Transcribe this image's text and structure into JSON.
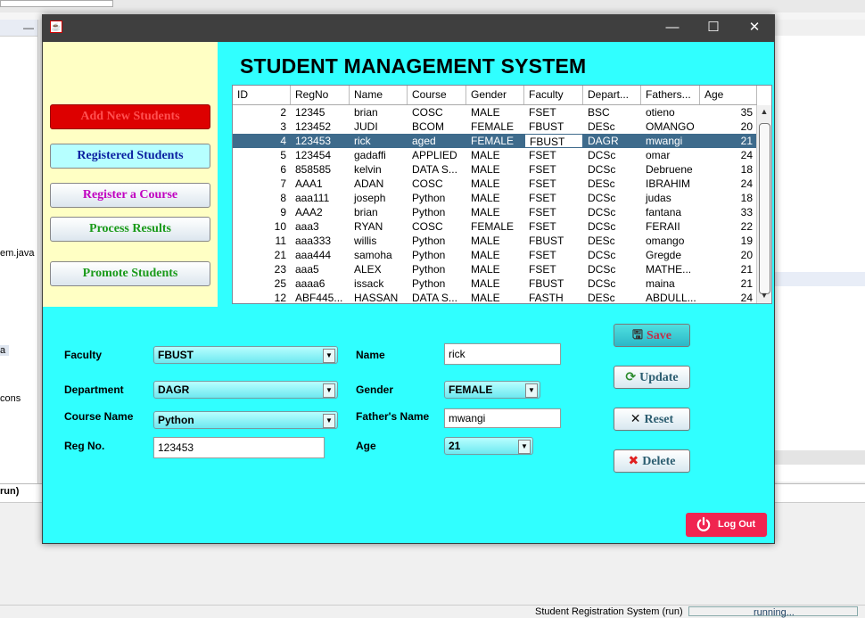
{
  "ide": {
    "left_file": "em.java",
    "left_a": "a",
    "left_icons": "cons",
    "run_label": "run)",
    "status_text": "Student Registration System (run)",
    "status_progress": "running..."
  },
  "window": {
    "minimize": "—",
    "maximize": "☐",
    "close": "✕"
  },
  "app": {
    "title": "STUDENT MANAGEMENT SYSTEM"
  },
  "nav": {
    "add_new": "Add New Students",
    "registered": "Registered Students",
    "register_course": "Register a Course",
    "process_results": "Process Results",
    "promote": "Promote Students"
  },
  "colors": {
    "client_bg": "#30ffff",
    "left_panel_bg": "#ffffc4",
    "selected_row": "#3e6b8c",
    "add_new_btn": "#dd0000",
    "logout_btn": "#f02550"
  },
  "table": {
    "columns": [
      "ID",
      "RegNo",
      "Name",
      "Course",
      "Gender",
      "Faculty",
      "Depart...",
      "Fathers...",
      "Age"
    ],
    "rows": [
      [
        "2",
        "12345",
        "brian",
        "COSC",
        "MALE",
        "FSET",
        "BSC",
        "otieno",
        "35"
      ],
      [
        "3",
        "123452",
        "JUDI",
        "BCOM",
        "FEMALE",
        "FBUST",
        "DESc",
        "OMANGO",
        "20"
      ],
      [
        "4",
        "123453",
        "rick",
        "aged",
        "FEMALE",
        "FBUST",
        "DAGR",
        "mwangi",
        "21"
      ],
      [
        "5",
        "123454",
        "gadaffi",
        "APPLIED",
        "MALE",
        "FSET",
        "DCSc",
        "omar",
        "24"
      ],
      [
        "6",
        "858585",
        "kelvin",
        "DATA S...",
        "MALE",
        "FSET",
        "DCSc",
        "Debruene",
        "18"
      ],
      [
        "7",
        "AAA1",
        "ADAN",
        "COSC",
        "MALE",
        "FSET",
        "DESc",
        "IBRAHIM",
        "24"
      ],
      [
        "8",
        "aaa111",
        "joseph",
        "Python",
        "MALE",
        "FSET",
        "DCSc",
        "judas",
        "18"
      ],
      [
        "9",
        "AAA2",
        "brian",
        "Python",
        "MALE",
        "FSET",
        "DCSc",
        "fantana",
        "33"
      ],
      [
        "10",
        "aaa3",
        "RYAN",
        "COSC",
        "FEMALE",
        "FSET",
        "DCSc",
        "FERAII",
        "22"
      ],
      [
        "11",
        "aaa333",
        "willis",
        "Python",
        "MALE",
        "FBUST",
        "DESc",
        "omango",
        "19"
      ],
      [
        "21",
        "aaa444",
        "samoha",
        "Python",
        "MALE",
        "FSET",
        "DCSc",
        "Gregde",
        "20"
      ],
      [
        "23",
        "aaa5",
        "ALEX",
        "Python",
        "MALE",
        "FSET",
        "DCSc",
        "MATHE...",
        "21"
      ],
      [
        "25",
        "aaaa6",
        "issack",
        "Python",
        "MALE",
        "FBUST",
        "DCSc",
        "maina",
        "21"
      ],
      [
        "12",
        "ABF445...",
        "HASSAN",
        "DATA S...",
        "MALE",
        "FASTH",
        "DESc",
        "ABDULL...",
        "24"
      ]
    ],
    "selected_index": 2
  },
  "form": {
    "faculty_label": "Faculty",
    "faculty_value": "FBUST",
    "department_label": "Department",
    "department_value": "DAGR",
    "course_label": "Course Name",
    "course_value": "Python",
    "regno_label": "Reg No.",
    "regno_value": "123453",
    "name_label": "Name",
    "name_value": "rick",
    "gender_label": "Gender",
    "gender_value": "FEMALE",
    "father_label": "Father's Name",
    "father_value": "mwangi",
    "age_label": "Age",
    "age_value": "21"
  },
  "actions": {
    "save": "Save",
    "update": "Update",
    "reset": "Reset",
    "delete": "Delete",
    "logout": "Log Out"
  }
}
